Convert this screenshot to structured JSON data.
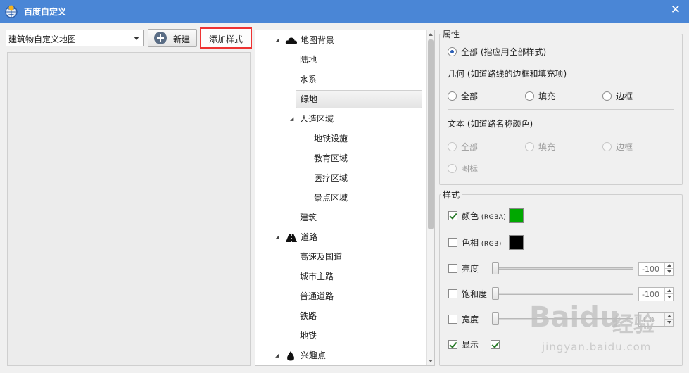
{
  "window": {
    "title": "百度自定义",
    "close_glyph": "✕"
  },
  "left": {
    "map_select_value": "建筑物自定义地图",
    "new_button": "新建",
    "add_style_button": "添加样式"
  },
  "tree": {
    "items": [
      {
        "label": "地图背景",
        "level": 0,
        "expanded": true,
        "icon": "cloud-icon"
      },
      {
        "label": "陆地",
        "level": 1
      },
      {
        "label": "水系",
        "level": 1
      },
      {
        "label": "绿地",
        "level": 1,
        "selected": true
      },
      {
        "label": "人造区域",
        "level": 1,
        "expanded": true
      },
      {
        "label": "地铁设施",
        "level": 2
      },
      {
        "label": "教育区域",
        "level": 2
      },
      {
        "label": "医疗区域",
        "level": 2
      },
      {
        "label": "景点区域",
        "level": 2
      },
      {
        "label": "建筑",
        "level": 1
      },
      {
        "label": "道路",
        "level": 0,
        "expanded": true,
        "icon": "road-icon"
      },
      {
        "label": "高速及国道",
        "level": 1
      },
      {
        "label": "城市主路",
        "level": 1
      },
      {
        "label": "普通道路",
        "level": 1
      },
      {
        "label": "铁路",
        "level": 1
      },
      {
        "label": "地铁",
        "level": 1
      },
      {
        "label": "兴趣点",
        "level": 0,
        "expanded": true,
        "icon": "drop-icon"
      }
    ]
  },
  "properties": {
    "group_title": "属性",
    "all_option": "全部 (指应用全部样式)",
    "geometry_label": "几何 (如道路线的边框和填充项)",
    "geometry_options": [
      "全部",
      "填充",
      "边框"
    ],
    "text_label": "文本 (如道路名称颜色)",
    "text_options": [
      "全部",
      "填充",
      "边框"
    ],
    "icon_option": "图标"
  },
  "style": {
    "group_title": "样式",
    "color_label": "颜色",
    "color_tag": "(RGBA)",
    "color_value": "#00a800",
    "hue_label": "色相",
    "hue_tag": "(RGB)",
    "hue_value": "#000000",
    "brightness_label": "亮度",
    "brightness_value": "-100",
    "saturation_label": "饱和度",
    "saturation_value": "-100",
    "width_label": "宽度",
    "width_value": "1.0",
    "visible_label": "显示"
  },
  "watermark": {
    "logo": "Baidu",
    "cn": "经验",
    "url": "jingyan.baidu.com"
  }
}
